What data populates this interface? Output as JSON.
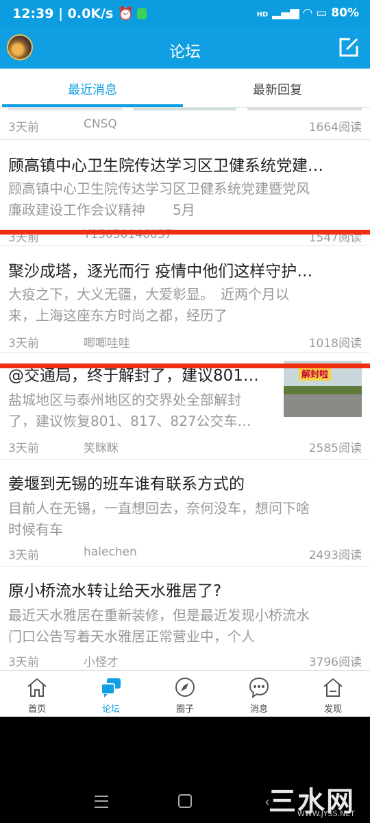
{
  "status_bar": {
    "time_speed": "12:39 | 0.0K/s",
    "battery": "80%",
    "network": "HD"
  },
  "app_bar": {
    "title": "论坛"
  },
  "tabs": [
    {
      "label": "最近消息"
    },
    {
      "label": "最新回复"
    }
  ],
  "posts": [
    {
      "title": "",
      "snippet": "",
      "time": "3天前",
      "author": "CNSQ",
      "views": "1664阅读"
    },
    {
      "title": "顾高镇中心卫生院传达学习区卫健系统党建…",
      "snippet_lines": [
        "顾高镇中心卫生院传达学习区卫健系统党建暨党风",
        "廉政建设工作会议精神　　5月"
      ],
      "time": "3天前",
      "author": "Y15050146037",
      "views": "1547阅读"
    },
    {
      "title": "聚沙成塔，逐光而行 疫情中他们这样守护…",
      "snippet_lines": [
        "大疫之下，大义无疆，大爱彰显。　近两个月以",
        "来，上海这座东方时尚之都，经历了"
      ],
      "time": "3天前",
      "author": "唧唧哇哇",
      "views": "1018阅读"
    },
    {
      "title": "@交通局，终于解封了，建议801…",
      "snippet_lines": [
        "盐城地区与泰州地区的交界处全部解封",
        "了，建议恢复801、817、827公交车…"
      ],
      "time": "3天前",
      "author": "笑眯眯",
      "views": "2585阅读",
      "thumb_tag": "解封啦"
    },
    {
      "title": "姜堰到无锡的班车谁有联系方式的",
      "snippet_lines": [
        "目前人在无锡，一直想回去，奈何没车，想问下啥",
        "时候有车"
      ],
      "time": "3天前",
      "author": "halechen",
      "views": "2493阅读"
    },
    {
      "title": "原小桥流水转让给天水雅居了?",
      "snippet_lines": [
        "最近天水雅居在重新装修，但是最近发现小桥流水",
        "门口公告写着天水雅居正常营业中，个人"
      ],
      "time": "3天前",
      "author": "小怪才",
      "views": "3796阅读"
    }
  ],
  "bottom_nav": [
    {
      "label": "首页",
      "icon": "home-icon"
    },
    {
      "label": "论坛",
      "icon": "forum-icon",
      "active": true
    },
    {
      "label": "圈子",
      "icon": "compass-icon"
    },
    {
      "label": "消息",
      "icon": "message-icon"
    },
    {
      "label": "发现",
      "icon": "discover-icon"
    }
  ],
  "watermark": {
    "text": "三水网",
    "url": "WWW.JYSS.NET"
  },
  "colors": {
    "primary": "#109fe3",
    "red_line": "#ef2e12"
  }
}
